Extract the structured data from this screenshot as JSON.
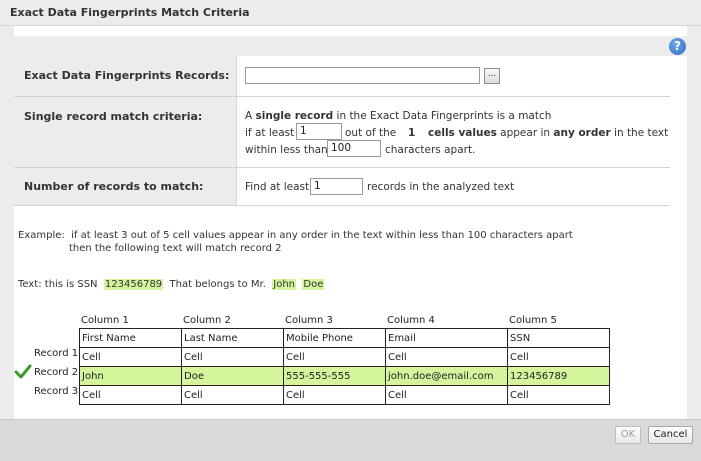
{
  "dialog": {
    "title": "Exact Data Fingerprints Match Criteria",
    "help_icon": "help-icon",
    "help_glyph": "?"
  },
  "form": {
    "records": {
      "label": "Exact Data Fingerprints Records:",
      "value": "",
      "browse_label": "..."
    },
    "single": {
      "label": "Single record match criteria:",
      "line1_prefix": "A",
      "line1_bold": "single record",
      "line1_suffix": "in the Exact Data Fingerprints is a match",
      "line2_prefix": "if at least",
      "at_least_value": "1",
      "line2_mid": "out of the",
      "total_cells": "1",
      "cells_values": "cells values",
      "appear_in": "appear in",
      "any_order": "any order",
      "in_the_text": "in the text",
      "line3_prefix": "within less than",
      "chars_value": "100",
      "line3_suffix": "characters apart."
    },
    "num_records": {
      "label": "Number of records to match:",
      "prefix": "Find at least",
      "value": "1",
      "suffix": "records in the analyzed text"
    }
  },
  "example": {
    "line1": "Example:  if at least 3 out of 5 cell values appear in any order in the text within less than 100 characters apart",
    "line2": "then the following text will match record 2",
    "text_prefix": "Text: this is SSN",
    "ssn": "123456789",
    "text_mid": "That belongs to Mr.",
    "first": "John",
    "last": "Doe"
  },
  "table": {
    "columns": [
      "Column 1",
      "Column 2",
      "Column 3",
      "Column 4",
      "Column 5"
    ],
    "header": [
      "First Name",
      "Last Name",
      "Mobile Phone",
      "Email",
      "SSN"
    ],
    "records": [
      {
        "label": "Record 1",
        "cells": [
          "Cell",
          "Cell",
          "Cell",
          "Cell",
          "Cell"
        ]
      },
      {
        "label": "Record 2",
        "cells": [
          "John",
          "Doe",
          "555-555-555",
          "john.doe@email.com",
          "123456789"
        ]
      },
      {
        "label": "Record 3",
        "cells": [
          "Cell",
          "Cell",
          "Cell",
          "Cell",
          "Cell"
        ]
      }
    ],
    "match_icon": "checkmark-icon"
  },
  "buttons": {
    "ok": "OK",
    "cancel": "Cancel"
  }
}
